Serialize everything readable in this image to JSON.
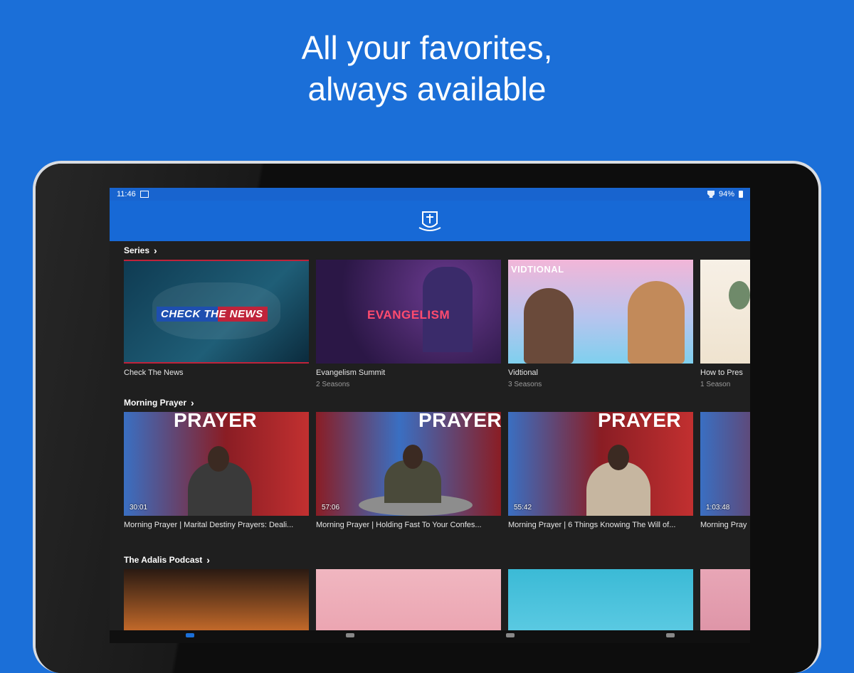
{
  "promo": {
    "line1": "All your favorites,",
    "line2": "always available"
  },
  "status_bar": {
    "time": "11:46",
    "battery": "94%"
  },
  "sections": [
    {
      "title": "Series",
      "cards": [
        {
          "thumb_text": "CHECK THE NEWS",
          "title": "Check The News",
          "subtitle": ""
        },
        {
          "thumb_text": "EVANGELISM",
          "title": "Evangelism Summit",
          "subtitle": "2 Seasons"
        },
        {
          "thumb_text": "VIDTIONAL",
          "title": "Vidtional",
          "subtitle": "3 Seasons"
        },
        {
          "thumb_text": "",
          "title": "How to Pres",
          "subtitle": "1 Season"
        }
      ]
    },
    {
      "title": "Morning Prayer",
      "cards": [
        {
          "thumb_text": "PRAYER",
          "title": "Morning Prayer | Marital Destiny Prayers: Deali...",
          "duration": "30:01"
        },
        {
          "thumb_text": "PRAYER",
          "title": "Morning Prayer | Holding Fast To Your Confes...",
          "duration": "57:06"
        },
        {
          "thumb_text": "PRAYER",
          "title": "Morning Prayer | 6 Things Knowing The Will of...",
          "duration": "55:42"
        },
        {
          "thumb_text": "",
          "title": "Morning Pray",
          "duration": "1:03:48"
        }
      ]
    },
    {
      "title": "The Adalis Podcast",
      "cards": [
        {
          "thumb_text": "",
          "title": ""
        },
        {
          "thumb_text": "",
          "title": ""
        },
        {
          "thumb_text": "",
          "title": ""
        },
        {
          "thumb_text": "",
          "title": ""
        }
      ]
    }
  ]
}
